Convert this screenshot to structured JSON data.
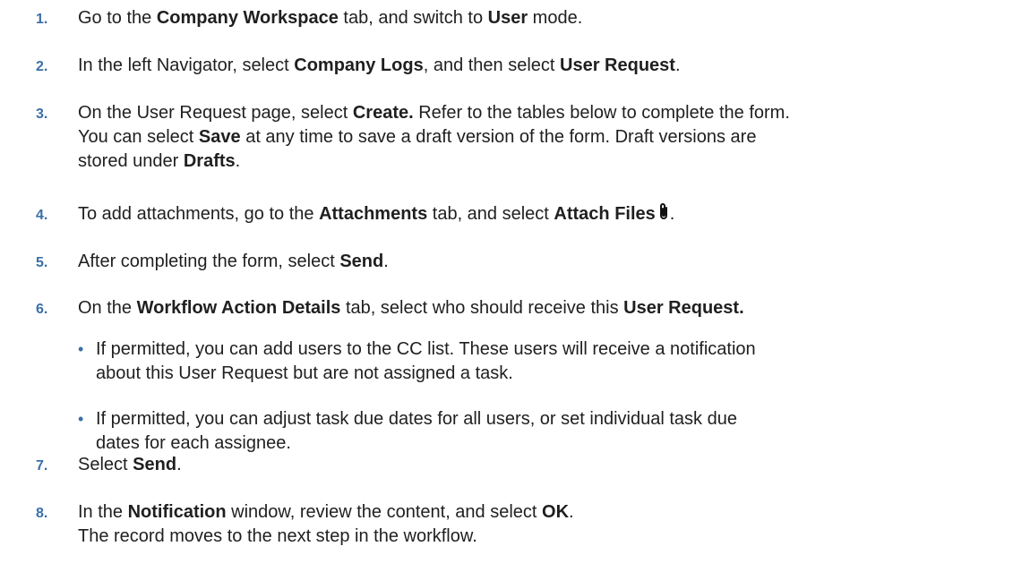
{
  "steps": [
    {
      "num": "1.",
      "parts": [
        {
          "t": "Go to the "
        },
        {
          "t": "Company Workspace",
          "b": true
        },
        {
          "t": " tab, and switch to "
        },
        {
          "t": "User",
          "b": true
        },
        {
          "t": " mode."
        }
      ]
    },
    {
      "num": "2.",
      "parts": [
        {
          "t": "In the left Navigator, select "
        },
        {
          "t": "Company Logs",
          "b": true
        },
        {
          "t": ", and then select "
        },
        {
          "t": "User Request",
          "b": true
        },
        {
          "t": "."
        }
      ]
    },
    {
      "num": "3.",
      "parts": [
        {
          "t": "On the User Request page, select "
        },
        {
          "t": "Create.",
          "b": true
        },
        {
          "t": " Refer to the tables below to complete the form."
        },
        {
          "br": true
        },
        {
          "t": "You can select "
        },
        {
          "t": "Save",
          "b": true
        },
        {
          "t": " at any time to save a draft version of the form. Draft versions are"
        },
        {
          "br": true
        },
        {
          "t": "stored under "
        },
        {
          "t": "Drafts",
          "b": true
        },
        {
          "t": "."
        }
      ]
    },
    {
      "num": "4.",
      "parts": [
        {
          "t": "To add attachments, go to the "
        },
        {
          "t": "Attachments",
          "b": true
        },
        {
          "t": " tab, and select "
        },
        {
          "t": "Attach Files",
          "b": true
        },
        {
          "icon": "paperclip-icon"
        },
        {
          "t": "."
        }
      ]
    },
    {
      "num": "5.",
      "parts": [
        {
          "t": "After completing the form, select "
        },
        {
          "t": "Send",
          "b": true
        },
        {
          "t": "."
        }
      ]
    },
    {
      "num": "6.",
      "parts": [
        {
          "t": "On the "
        },
        {
          "t": "Workflow Action Details",
          "b": true
        },
        {
          "t": " tab, select who should receive this "
        },
        {
          "t": "User Request.",
          "b": true
        }
      ],
      "bullets": [
        "If permitted, you can add users to the CC list. These users will receive a notification\nabout this User Request but are not assigned a task.",
        "If permitted, you can adjust task due dates for all users, or set individual task due\ndates for each assignee."
      ]
    },
    {
      "num": "7.",
      "parts": [
        {
          "t": "Select "
        },
        {
          "t": "Send",
          "b": true
        },
        {
          "t": "."
        }
      ]
    },
    {
      "num": "8.",
      "parts": [
        {
          "t": "In the "
        },
        {
          "t": "Notification",
          "b": true
        },
        {
          "t": " window, review the content, and select "
        },
        {
          "t": "OK",
          "b": true
        },
        {
          "t": "."
        },
        {
          "br": true
        },
        {
          "t": "The record moves to the next step in the workflow."
        }
      ]
    }
  ],
  "bullet_symbol": "•",
  "colors": {
    "number": "#3a6fa8",
    "text": "#1f1f1f"
  }
}
